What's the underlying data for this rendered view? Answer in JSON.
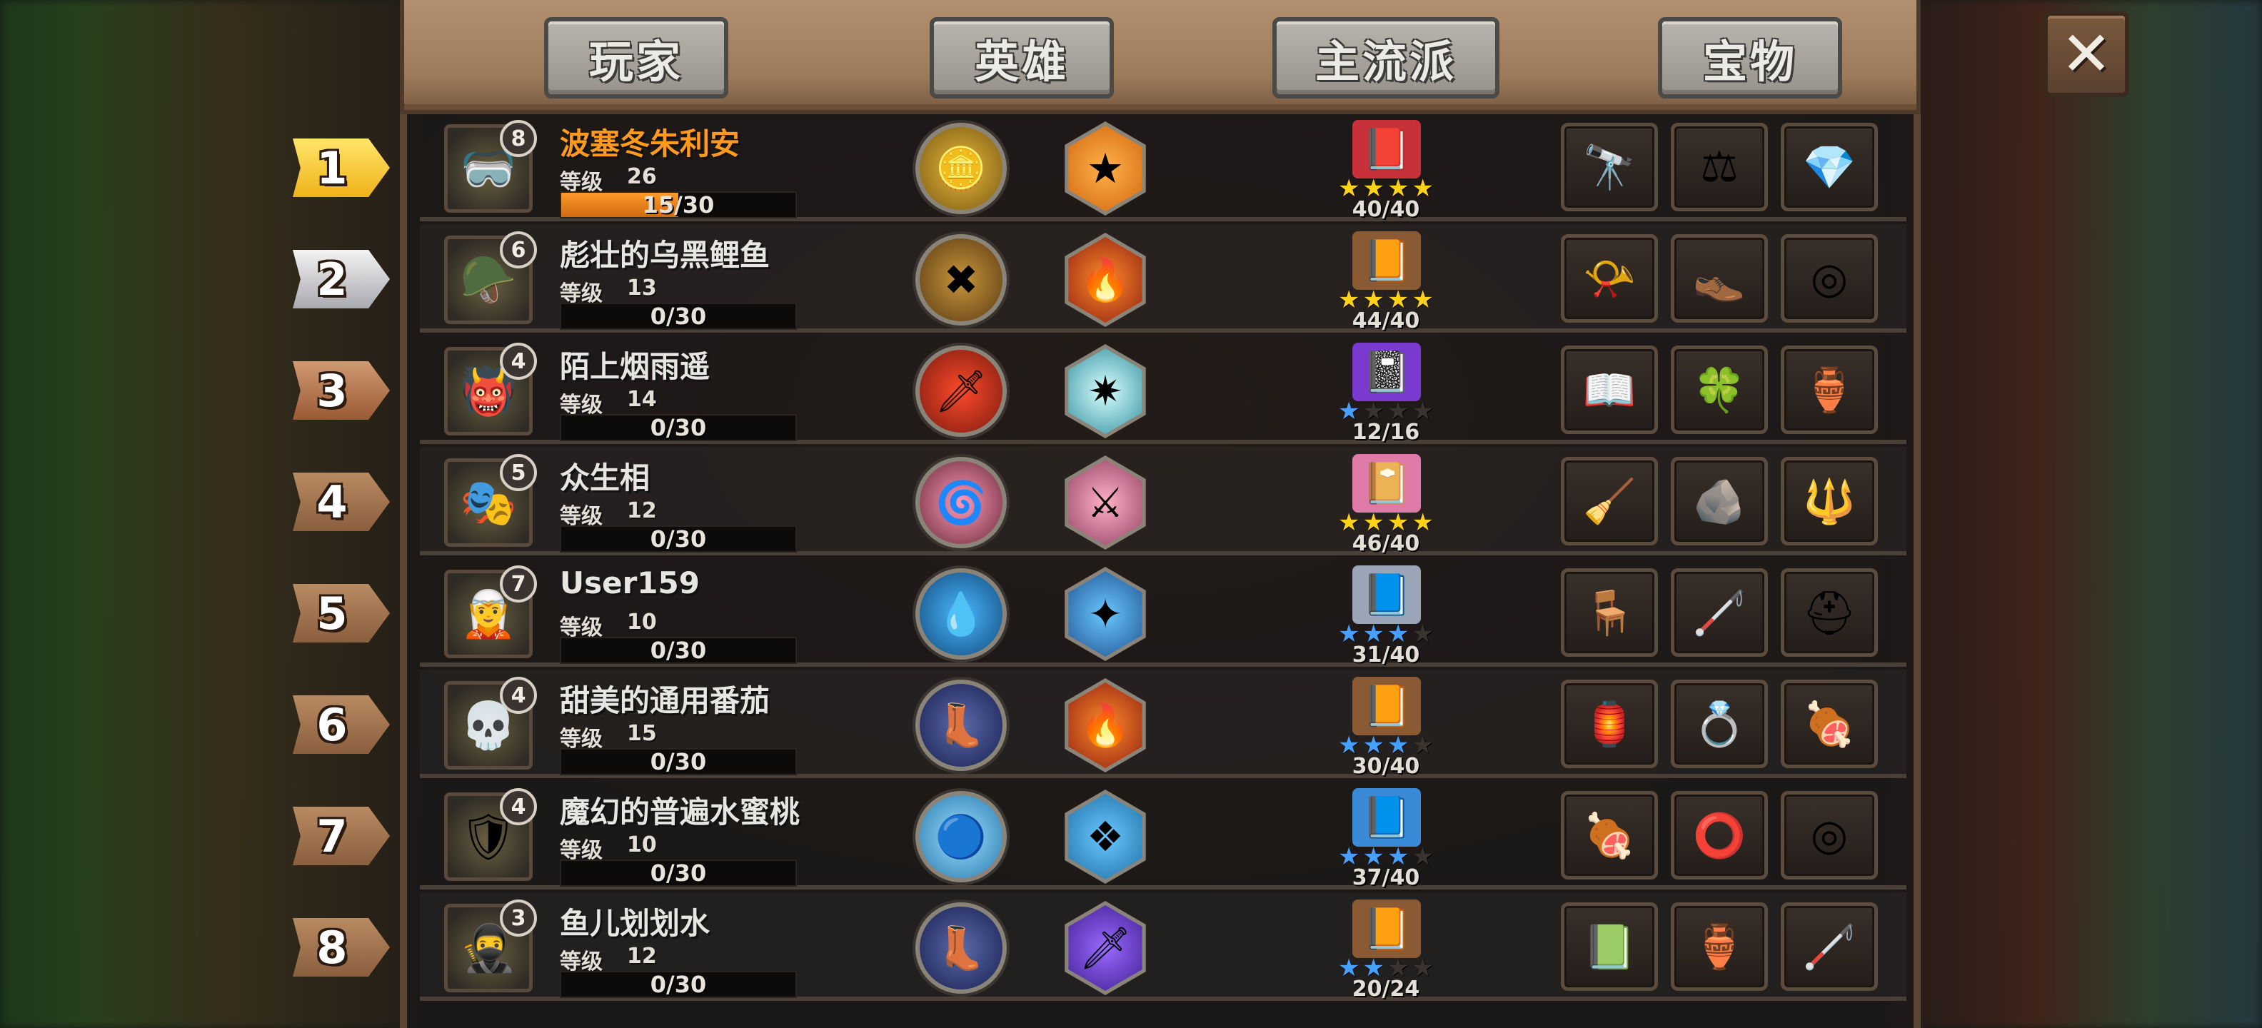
{
  "tabs": {
    "player": "玩家",
    "hero": "英雄",
    "main_school": "主流派",
    "treasure": "宝物"
  },
  "close_label": "✕",
  "level_label": "等级",
  "rows": [
    {
      "rank": "1",
      "name": "波塞冬朱利安",
      "level_badge": "8",
      "level": "26",
      "xp": "15/30",
      "xp_fraction": 0.5,
      "avatar_icon": "goggle-hero-icon",
      "skill1_icon": "gold-coins-icon",
      "skill2_icon": "gold-medal-icon",
      "book_icon": "red-book-icon",
      "stars_filled": 4,
      "star_color": "gold",
      "school": "40/40",
      "treasures": [
        "telescope-icon",
        "scales-icon",
        "dark-gem-icon"
      ]
    },
    {
      "rank": "2",
      "name": "彪壮的乌黑鲤鱼",
      "level_badge": "6",
      "level": "13",
      "xp": "0/30",
      "xp_fraction": 0,
      "avatar_icon": "mohawk-warrior-icon",
      "skill1_icon": "crossed-wood-icon",
      "skill2_icon": "fire-burst-icon",
      "book_icon": "brown-book-icon",
      "stars_filled": 4,
      "star_color": "gold",
      "school": "44/40",
      "treasures": [
        "horn-icon",
        "red-boot-icon",
        "silver-coin-icon"
      ]
    },
    {
      "rank": "3",
      "name": "陌上烟雨遥",
      "level_badge": "4",
      "level": "14",
      "xp": "0/30",
      "xp_fraction": 0,
      "avatar_icon": "green-ogre-icon",
      "skill1_icon": "sword-strike-icon",
      "skill2_icon": "ice-spark-icon",
      "book_icon": "purple-book-icon",
      "stars_filled": 1,
      "star_color": "blue",
      "school": "12/16",
      "treasures": [
        "spell-book-icon",
        "clover-icon",
        "jade-amulet-icon"
      ]
    },
    {
      "rank": "4",
      "name": "众生相",
      "level_badge": "5",
      "level": "12",
      "xp": "0/30",
      "xp_fraction": 0,
      "avatar_icon": "masked-knight-icon",
      "skill1_icon": "pink-vortex-icon",
      "skill2_icon": "pink-slash-icon",
      "book_icon": "pink-book-icon",
      "stars_filled": 4,
      "star_color": "gold",
      "school": "46/40",
      "treasures": [
        "broom-icon",
        "dark-stone-icon",
        "spear-icon"
      ]
    },
    {
      "rank": "5",
      "name": "User159",
      "level_badge": "7",
      "level": "10",
      "xp": "0/30",
      "xp_fraction": 0,
      "avatar_icon": "blue-mage-icon",
      "skill1_icon": "water-swirl-icon",
      "skill2_icon": "blue-sparkle-icon",
      "book_icon": "grey-book-icon",
      "stars_filled": 3,
      "star_color": "blue",
      "school": "31/40",
      "treasures": [
        "table-icon",
        "staff-icon",
        "horned-helmet-icon"
      ]
    },
    {
      "rank": "6",
      "name": "甜美的通用番茄",
      "level_badge": "4",
      "level": "15",
      "xp": "0/30",
      "xp_fraction": 0,
      "avatar_icon": "hooded-skull-icon",
      "skill1_icon": "green-boot-icon",
      "skill2_icon": "fire-burst-icon",
      "book_icon": "brown-book-icon",
      "stars_filled": 3,
      "star_color": "blue",
      "school": "30/40",
      "treasures": [
        "lantern-icon",
        "ring-icon",
        "meat-crate-icon"
      ]
    },
    {
      "rank": "7",
      "name": "魔幻的普遍水蜜桃",
      "level_badge": "4",
      "level": "10",
      "xp": "0/30",
      "xp_fraction": 0,
      "avatar_icon": "violet-knight-icon",
      "skill1_icon": "ice-orb-icon",
      "skill2_icon": "ice-crystal-icon",
      "book_icon": "blue-book-icon",
      "stars_filled": 3,
      "star_color": "blue",
      "school": "37/40",
      "treasures": [
        "meat-crate-icon",
        "silver-ring-icon",
        "silver-coin-icon"
      ]
    },
    {
      "rank": "8",
      "name": "鱼儿划划水",
      "level_badge": "3",
      "level": "12",
      "xp": "0/30",
      "xp_fraction": 0,
      "avatar_icon": "dark-hood-icon",
      "skill1_icon": "green-boot-icon",
      "skill2_icon": "kunai-icon",
      "book_icon": "brown-book-icon",
      "stars_filled": 2,
      "star_color": "blue",
      "school": "20/24",
      "treasures": [
        "green-book-icon",
        "jade-amulet-icon",
        "staff-icon"
      ]
    }
  ]
}
